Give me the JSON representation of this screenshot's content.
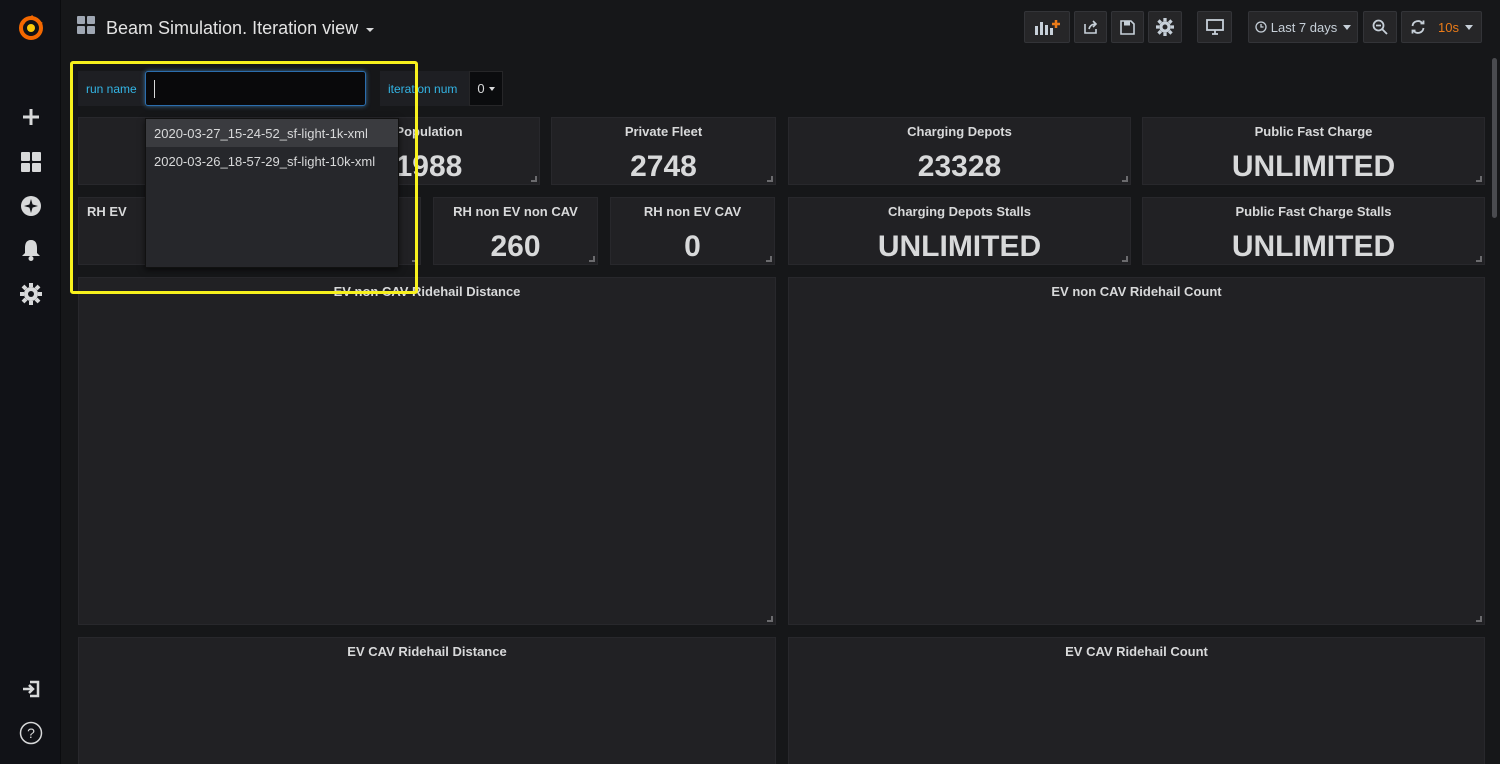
{
  "dashboard": {
    "title": "Beam Simulation. Iteration view"
  },
  "toolbar": {
    "time_range": "Last 7 days",
    "refresh_interval": "10s"
  },
  "variables": {
    "run_name": {
      "label": "run name",
      "value": "",
      "options": [
        "2020-03-27_15-24-52_sf-light-1k-xml",
        "2020-03-26_18-57-29_sf-light-10k-xml"
      ]
    },
    "iteration_num": {
      "label": "iteration num",
      "value": "0"
    }
  },
  "stats_row1": [
    {
      "title": "Population",
      "value": "1988"
    },
    {
      "title": "Private Fleet",
      "value": "2748"
    },
    {
      "title": "Charging Depots",
      "value": "23328"
    },
    {
      "title": "Public Fast Charge",
      "value": "UNLIMITED"
    }
  ],
  "stats_row2": [
    {
      "title": "RH EV",
      "value": ""
    },
    {
      "title": "RH non EV non CAV",
      "value": "260"
    },
    {
      "title": "RH non EV CAV",
      "value": "0"
    },
    {
      "title": "Charging Depots Stalls",
      "value": "UNLIMITED"
    },
    {
      "title": "Public Fast Charge Stalls",
      "value": "UNLIMITED"
    }
  ],
  "graphs": [
    {
      "title": "EV non CAV Ridehail Distance"
    },
    {
      "title": "EV non CAV Ridehail Count"
    },
    {
      "title": "EV CAV Ridehail Distance"
    },
    {
      "title": "EV CAV Ridehail Count"
    }
  ],
  "colors": {
    "accent_orange": "#eb7b18",
    "variable_label": "#33b5e5",
    "highlight": "#f7f11d"
  }
}
